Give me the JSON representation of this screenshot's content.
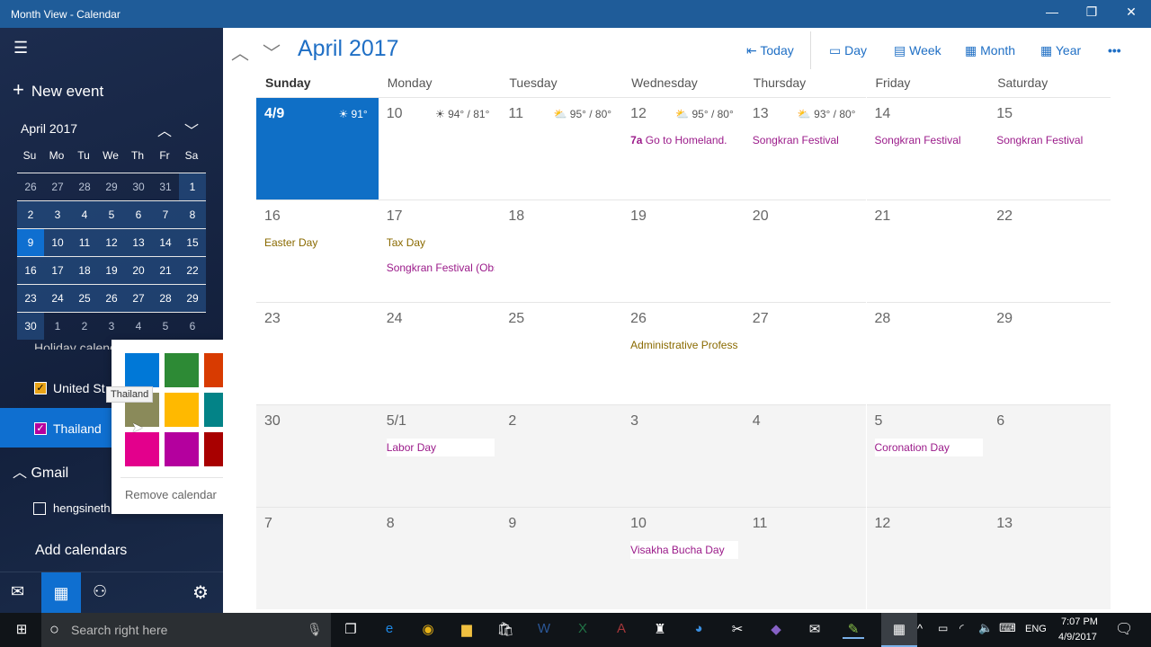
{
  "window": {
    "title": "Month View - Calendar",
    "minimize": "—",
    "restore": "❐",
    "close": "✕"
  },
  "sidebar": {
    "new_event": "New event",
    "mini_month": "April 2017",
    "weekday_heads": [
      "Su",
      "Mo",
      "Tu",
      "We",
      "Th",
      "Fr",
      "Sa"
    ],
    "mini_days": [
      [
        "26",
        "27",
        "28",
        "29",
        "30",
        "31",
        "1"
      ],
      [
        "2",
        "3",
        "4",
        "5",
        "6",
        "7",
        "8"
      ],
      [
        "9",
        "10",
        "11",
        "12",
        "13",
        "14",
        "15"
      ],
      [
        "16",
        "17",
        "18",
        "19",
        "20",
        "21",
        "22"
      ],
      [
        "23",
        "24",
        "25",
        "26",
        "27",
        "28",
        "29"
      ],
      [
        "30",
        "1",
        "2",
        "3",
        "4",
        "5",
        "6"
      ]
    ],
    "mini_today": "9",
    "group_partial": "Holiday calendars",
    "calendars": [
      {
        "label": "United St",
        "checked": true,
        "color": "#e8a317"
      },
      {
        "label": "Thailand",
        "checked": true,
        "color": "#b4009e"
      }
    ],
    "gmail_group": "Gmail",
    "gmail_account": "hengsineth",
    "add_calendars": "Add calendars"
  },
  "popup": {
    "tooltip": "Thailand",
    "colors": [
      "#0078d7",
      "#2d8a35",
      "#d83b01",
      "#8a8a5a",
      "#ffb900",
      "#038387",
      "#e3008c",
      "#b4009e",
      "#a80000"
    ],
    "selected_index": 7,
    "remove": "Remove calendar"
  },
  "header": {
    "title": "April 2017",
    "today": "Today",
    "day": "Day",
    "week": "Week",
    "month": "Month",
    "year": "Year",
    "more": "•••"
  },
  "weekdays": [
    "Sunday",
    "Monday",
    "Tuesday",
    "Wednesday",
    "Thursday",
    "Friday",
    "Saturday"
  ],
  "weeks": [
    [
      {
        "d": "4/9",
        "wx": "☀ 91°",
        "today": true
      },
      {
        "d": "10",
        "wx": "☀ 94° / 81°"
      },
      {
        "d": "11",
        "wx": "⛅ 95° / 80°"
      },
      {
        "d": "12",
        "wx": "⛅ 95° / 80°",
        "ev": [
          {
            "time": "7a",
            "t": "Go to Homeland.",
            "c": "#9b1b8a"
          }
        ]
      },
      {
        "d": "13",
        "wx": "⛅ 93° / 80°",
        "ev": [
          {
            "t": "Songkran Festival",
            "c": "#9b1b8a"
          }
        ]
      },
      {
        "d": "14",
        "ev": [
          {
            "t": "Songkran Festival",
            "c": "#9b1b8a"
          }
        ]
      },
      {
        "d": "15",
        "ev": [
          {
            "t": "Songkran Festival",
            "c": "#9b1b8a"
          }
        ]
      }
    ],
    [
      {
        "d": "16",
        "ev": [
          {
            "t": "Easter Day",
            "c": "#8a6a00"
          }
        ]
      },
      {
        "d": "17",
        "ev": [
          {
            "t": "Tax Day",
            "c": "#8a6a00"
          },
          {
            "t": "Songkran Festival (Obs",
            "c": "#9b1b8a"
          }
        ]
      },
      {
        "d": "18"
      },
      {
        "d": "19"
      },
      {
        "d": "20"
      },
      {
        "d": "21"
      },
      {
        "d": "22"
      }
    ],
    [
      {
        "d": "23"
      },
      {
        "d": "24"
      },
      {
        "d": "25"
      },
      {
        "d": "26",
        "ev": [
          {
            "t": "Administrative Professi",
            "c": "#8a6a00"
          }
        ]
      },
      {
        "d": "27"
      },
      {
        "d": "28"
      },
      {
        "d": "29"
      }
    ],
    [
      {
        "d": "30"
      },
      {
        "d": "5/1",
        "other": true,
        "ev": [
          {
            "t": "Labor Day",
            "c": "#9b1b8a"
          }
        ]
      },
      {
        "d": "2",
        "other": true
      },
      {
        "d": "3",
        "other": true
      },
      {
        "d": "4",
        "other": true
      },
      {
        "d": "5",
        "other": true,
        "ev": [
          {
            "t": "Coronation Day",
            "c": "#9b1b8a"
          }
        ]
      },
      {
        "d": "6",
        "other": true
      }
    ],
    [
      {
        "d": "7",
        "other": true
      },
      {
        "d": "8",
        "other": true
      },
      {
        "d": "9",
        "other": true
      },
      {
        "d": "10",
        "other": true,
        "ev": [
          {
            "t": "Visakha Bucha Day",
            "c": "#9b1b8a"
          }
        ]
      },
      {
        "d": "11",
        "other": true
      },
      {
        "d": "12",
        "other": true
      },
      {
        "d": "13",
        "other": true
      }
    ]
  ],
  "taskbar": {
    "search_placeholder": "Search right here",
    "lang": "ENG",
    "time": "7:07 PM",
    "date": "4/9/2017",
    "apps": [
      "task-view",
      "edge",
      "chrome",
      "file-explorer",
      "store",
      "word",
      "excel",
      "access",
      "app",
      "network",
      "tools",
      "visual-studio",
      "mail",
      "notepad",
      "calendar"
    ]
  }
}
